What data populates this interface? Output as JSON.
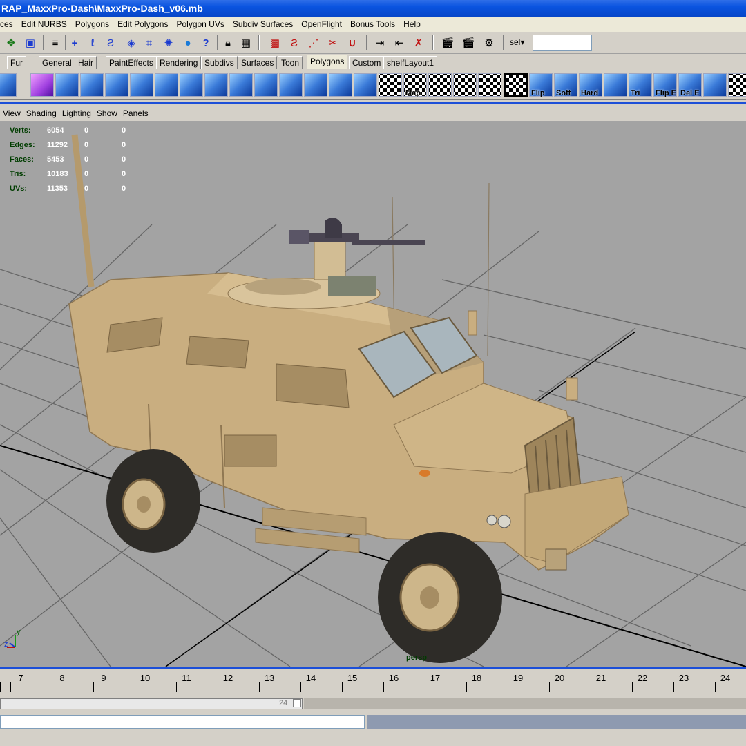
{
  "window": {
    "title": "RAP_MaxxPro-Dash\\MaxxPro-Dash_v06.mb"
  },
  "menubar": [
    "ces",
    "Edit NURBS",
    "Polygons",
    "Edit Polygons",
    "Polygon UVs",
    "Subdiv Surfaces",
    "OpenFlight",
    "Bonus Tools",
    "Help"
  ],
  "statusline": {
    "tools": [
      "move-icon",
      "select-icon",
      "hierarchy-icon",
      "add-icon",
      "lasso-icon",
      "curve-icon",
      "surface-icon",
      "grid-icon",
      "light-icon",
      "sphere-icon",
      "help-icon",
      "lock-icon",
      "snap-icon",
      "snap-grid-icon",
      "snap-curve-icon",
      "snap-point-icon",
      "magnet-icon",
      "input-icon",
      "output-icon",
      "history-icon",
      "render-icon",
      "ipr-icon",
      "render-settings-icon"
    ],
    "sel_label": "sel",
    "sel_value": ""
  },
  "shelf_tabs": [
    "Fur",
    "General",
    "Hair",
    "PaintEffects",
    "Rendering",
    "Subdivs",
    "Surfaces",
    "Toon",
    "Polygons",
    "Custom",
    "shelfLayout1"
  ],
  "active_shelf_tab": "Polygons",
  "shelf_labels": {
    "map": "Map",
    "flip": "Flip",
    "soft": "Soft",
    "hard": "Hard",
    "tri": "Tri",
    "flipe": "Flip E",
    "dele": "Del E"
  },
  "panel_menu": [
    "View",
    "Shading",
    "Lighting",
    "Show",
    "Panels"
  ],
  "hud": {
    "rows": [
      {
        "label": "Verts:",
        "v1": "6054",
        "v2": "0",
        "v3": "0"
      },
      {
        "label": "Edges:",
        "v1": "11292",
        "v2": "0",
        "v3": "0"
      },
      {
        "label": "Faces:",
        "v1": "5453",
        "v2": "0",
        "v3": "0"
      },
      {
        "label": "Tris:",
        "v1": "10183",
        "v2": "0",
        "v3": "0"
      },
      {
        "label": "UVs:",
        "v1": "11353",
        "v2": "0",
        "v3": "0"
      }
    ]
  },
  "camera_label": "persp",
  "axis": {
    "y": "y",
    "z": "z"
  },
  "timeline": {
    "frames": [
      "7",
      "8",
      "9",
      "10",
      "11",
      "12",
      "13",
      "14",
      "15",
      "16",
      "17",
      "18",
      "19",
      "20",
      "21",
      "22",
      "23",
      "24"
    ]
  },
  "range": {
    "end": "24"
  },
  "colors": {
    "title_bar": "#0a54e0",
    "viewport_bg": "#a3a3a3",
    "vehicle": "#c9ae80",
    "hud_label": "#003d00"
  }
}
